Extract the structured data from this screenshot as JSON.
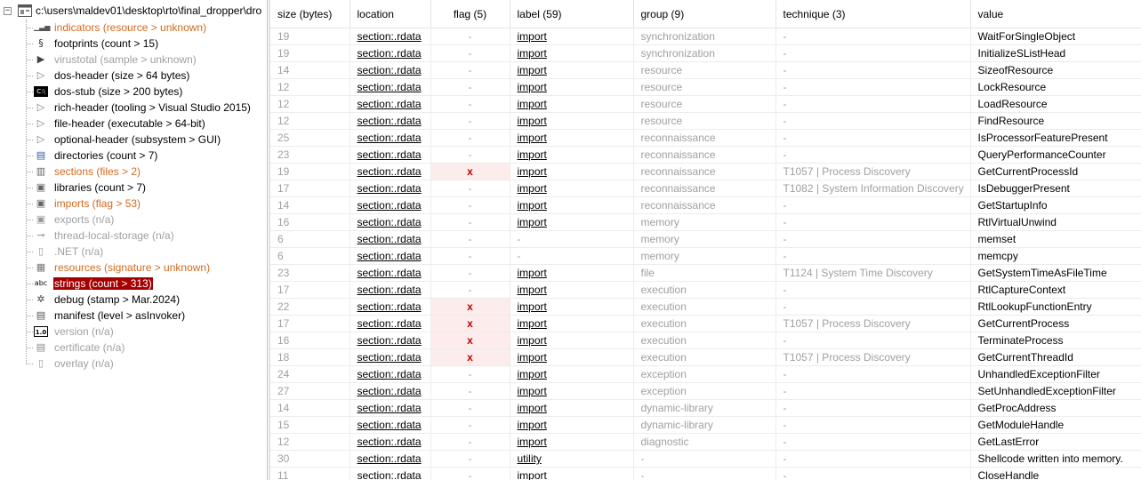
{
  "tree": {
    "root_label": "c:\\users\\maldev01\\desktop\\rto\\final_dropper\\dro",
    "expander": "−",
    "nodes": [
      {
        "label": "indicators (resource > unknown)",
        "color": "orange",
        "icon": "indicators-icon",
        "glyph": "▁▃▅"
      },
      {
        "label": "footprints (count > 15)",
        "color": "black",
        "icon": "fingerprint-icon",
        "glyph": "§"
      },
      {
        "label": "virustotal (sample > unknown)",
        "color": "gray",
        "icon": "virustotal-icon",
        "glyph": "▶"
      },
      {
        "label": "dos-header (size > 64 bytes)",
        "color": "black",
        "icon": "arrow-icon",
        "glyph": "▷"
      },
      {
        "label": "dos-stub (size > 200 bytes)",
        "color": "black",
        "icon": "console-icon",
        "glyph": "C:\\"
      },
      {
        "label": "rich-header (tooling > Visual Studio 2015)",
        "color": "black",
        "icon": "arrow-icon",
        "glyph": "▷"
      },
      {
        "label": "file-header (executable > 64-bit)",
        "color": "black",
        "icon": "arrow-icon",
        "glyph": "▷"
      },
      {
        "label": "optional-header (subsystem > GUI)",
        "color": "black",
        "icon": "arrow-icon",
        "glyph": "▷"
      },
      {
        "label": "directories (count > 7)",
        "color": "black",
        "icon": "directories-icon",
        "glyph": "▤"
      },
      {
        "label": "sections (files > 2)",
        "color": "orange",
        "icon": "sections-icon",
        "glyph": "▥"
      },
      {
        "label": "libraries (count > 7)",
        "color": "black",
        "icon": "libraries-icon",
        "glyph": "▣"
      },
      {
        "label": "imports (flag > 53)",
        "color": "orange",
        "icon": "imports-icon",
        "glyph": "▣"
      },
      {
        "label": "exports (n/a)",
        "color": "gray",
        "icon": "exports-icon",
        "glyph": "▣"
      },
      {
        "label": "thread-local-storage (n/a)",
        "color": "gray",
        "icon": "tls-icon",
        "glyph": "⊸"
      },
      {
        "label": ".NET (n/a)",
        "color": "gray",
        "icon": "dotnet-icon",
        "glyph": "▯"
      },
      {
        "label": "resources (signature > unknown)",
        "color": "orange",
        "icon": "resources-icon",
        "glyph": "▦"
      },
      {
        "label": "strings (count > 313)",
        "color": "selected",
        "icon": "strings-icon",
        "glyph": "abc"
      },
      {
        "label": "debug (stamp > Mar.2024)",
        "color": "black",
        "icon": "debug-icon",
        "glyph": "✲"
      },
      {
        "label": "manifest (level > asInvoker)",
        "color": "black",
        "icon": "manifest-icon",
        "glyph": "▤"
      },
      {
        "label": "version (n/a)",
        "color": "gray",
        "icon": "version-icon",
        "glyph": "1.0"
      },
      {
        "label": "certificate (n/a)",
        "color": "gray",
        "icon": "certificate-icon",
        "glyph": "▤"
      },
      {
        "label": "overlay (n/a)",
        "color": "gray",
        "icon": "overlay-icon",
        "glyph": "▯"
      }
    ]
  },
  "grid": {
    "columns": [
      "size (bytes)",
      "location",
      "flag (5)",
      "label (59)",
      "group (9)",
      "technique (3)",
      "value"
    ],
    "rows": [
      {
        "size": "19",
        "location": "section:.rdata",
        "flag": "-",
        "label": "import",
        "group": "synchronization",
        "technique": "-",
        "value": "WaitForSingleObject"
      },
      {
        "size": "19",
        "location": "section:.rdata",
        "flag": "-",
        "label": "import",
        "group": "synchronization",
        "technique": "-",
        "value": "InitializeSListHead"
      },
      {
        "size": "14",
        "location": "section:.rdata",
        "flag": "-",
        "label": "import",
        "group": "resource",
        "technique": "-",
        "value": "SizeofResource"
      },
      {
        "size": "12",
        "location": "section:.rdata",
        "flag": "-",
        "label": "import",
        "group": "resource",
        "technique": "-",
        "value": "LockResource"
      },
      {
        "size": "12",
        "location": "section:.rdata",
        "flag": "-",
        "label": "import",
        "group": "resource",
        "technique": "-",
        "value": "LoadResource"
      },
      {
        "size": "12",
        "location": "section:.rdata",
        "flag": "-",
        "label": "import",
        "group": "resource",
        "technique": "-",
        "value": "FindResource"
      },
      {
        "size": "25",
        "location": "section:.rdata",
        "flag": "-",
        "label": "import",
        "group": "reconnaissance",
        "technique": "-",
        "value": "IsProcessorFeaturePresent"
      },
      {
        "size": "23",
        "location": "section:.rdata",
        "flag": "-",
        "label": "import",
        "group": "reconnaissance",
        "technique": "-",
        "value": "QueryPerformanceCounter"
      },
      {
        "size": "19",
        "location": "section:.rdata",
        "flag": "x",
        "label": "import",
        "group": "reconnaissance",
        "technique": "T1057 | Process Discovery",
        "value": "GetCurrentProcessId"
      },
      {
        "size": "17",
        "location": "section:.rdata",
        "flag": "-",
        "label": "import",
        "group": "reconnaissance",
        "technique": "T1082 | System Information Discovery",
        "value": "IsDebuggerPresent"
      },
      {
        "size": "14",
        "location": "section:.rdata",
        "flag": "-",
        "label": "import",
        "group": "reconnaissance",
        "technique": "-",
        "value": "GetStartupInfo"
      },
      {
        "size": "16",
        "location": "section:.rdata",
        "flag": "-",
        "label": "import",
        "group": "memory",
        "technique": "-",
        "value": "RtlVirtualUnwind"
      },
      {
        "size": "6",
        "location": "section:.rdata",
        "flag": "-",
        "label": "-",
        "group": "memory",
        "technique": "-",
        "value": "memset"
      },
      {
        "size": "6",
        "location": "section:.rdata",
        "flag": "-",
        "label": "-",
        "group": "memory",
        "technique": "-",
        "value": "memcpy"
      },
      {
        "size": "23",
        "location": "section:.rdata",
        "flag": "-",
        "label": "import",
        "group": "file",
        "technique": "T1124 | System Time Discovery",
        "value": "GetSystemTimeAsFileTime"
      },
      {
        "size": "17",
        "location": "section:.rdata",
        "flag": "-",
        "label": "import",
        "group": "execution",
        "technique": "-",
        "value": "RtlCaptureContext"
      },
      {
        "size": "22",
        "location": "section:.rdata",
        "flag": "x",
        "label": "import",
        "group": "execution",
        "technique": "-",
        "value": "RtlLookupFunctionEntry"
      },
      {
        "size": "17",
        "location": "section:.rdata",
        "flag": "x",
        "label": "import",
        "group": "execution",
        "technique": "T1057 | Process Discovery",
        "value": "GetCurrentProcess"
      },
      {
        "size": "16",
        "location": "section:.rdata",
        "flag": "x",
        "label": "import",
        "group": "execution",
        "technique": "-",
        "value": "TerminateProcess"
      },
      {
        "size": "18",
        "location": "section:.rdata",
        "flag": "x",
        "label": "import",
        "group": "execution",
        "technique": "T1057 | Process Discovery",
        "value": "GetCurrentThreadId"
      },
      {
        "size": "24",
        "location": "section:.rdata",
        "flag": "-",
        "label": "import",
        "group": "exception",
        "technique": "-",
        "value": "UnhandledExceptionFilter"
      },
      {
        "size": "27",
        "location": "section:.rdata",
        "flag": "-",
        "label": "import",
        "group": "exception",
        "technique": "-",
        "value": "SetUnhandledExceptionFilter"
      },
      {
        "size": "14",
        "location": "section:.rdata",
        "flag": "-",
        "label": "import",
        "group": "dynamic-library",
        "technique": "-",
        "value": "GetProcAddress"
      },
      {
        "size": "15",
        "location": "section:.rdata",
        "flag": "-",
        "label": "import",
        "group": "dynamic-library",
        "technique": "-",
        "value": "GetModuleHandle"
      },
      {
        "size": "12",
        "location": "section:.rdata",
        "flag": "-",
        "label": "import",
        "group": "diagnostic",
        "technique": "-",
        "value": "GetLastError"
      },
      {
        "size": "30",
        "location": "section:.rdata",
        "flag": "-",
        "label": "utility",
        "group": "-",
        "technique": "-",
        "value": "Shellcode written into memory."
      },
      {
        "size": "11",
        "location": "section:.rdata",
        "flag": "-",
        "label": "import",
        "group": "-",
        "technique": "-",
        "value": "CloseHandle"
      }
    ]
  }
}
